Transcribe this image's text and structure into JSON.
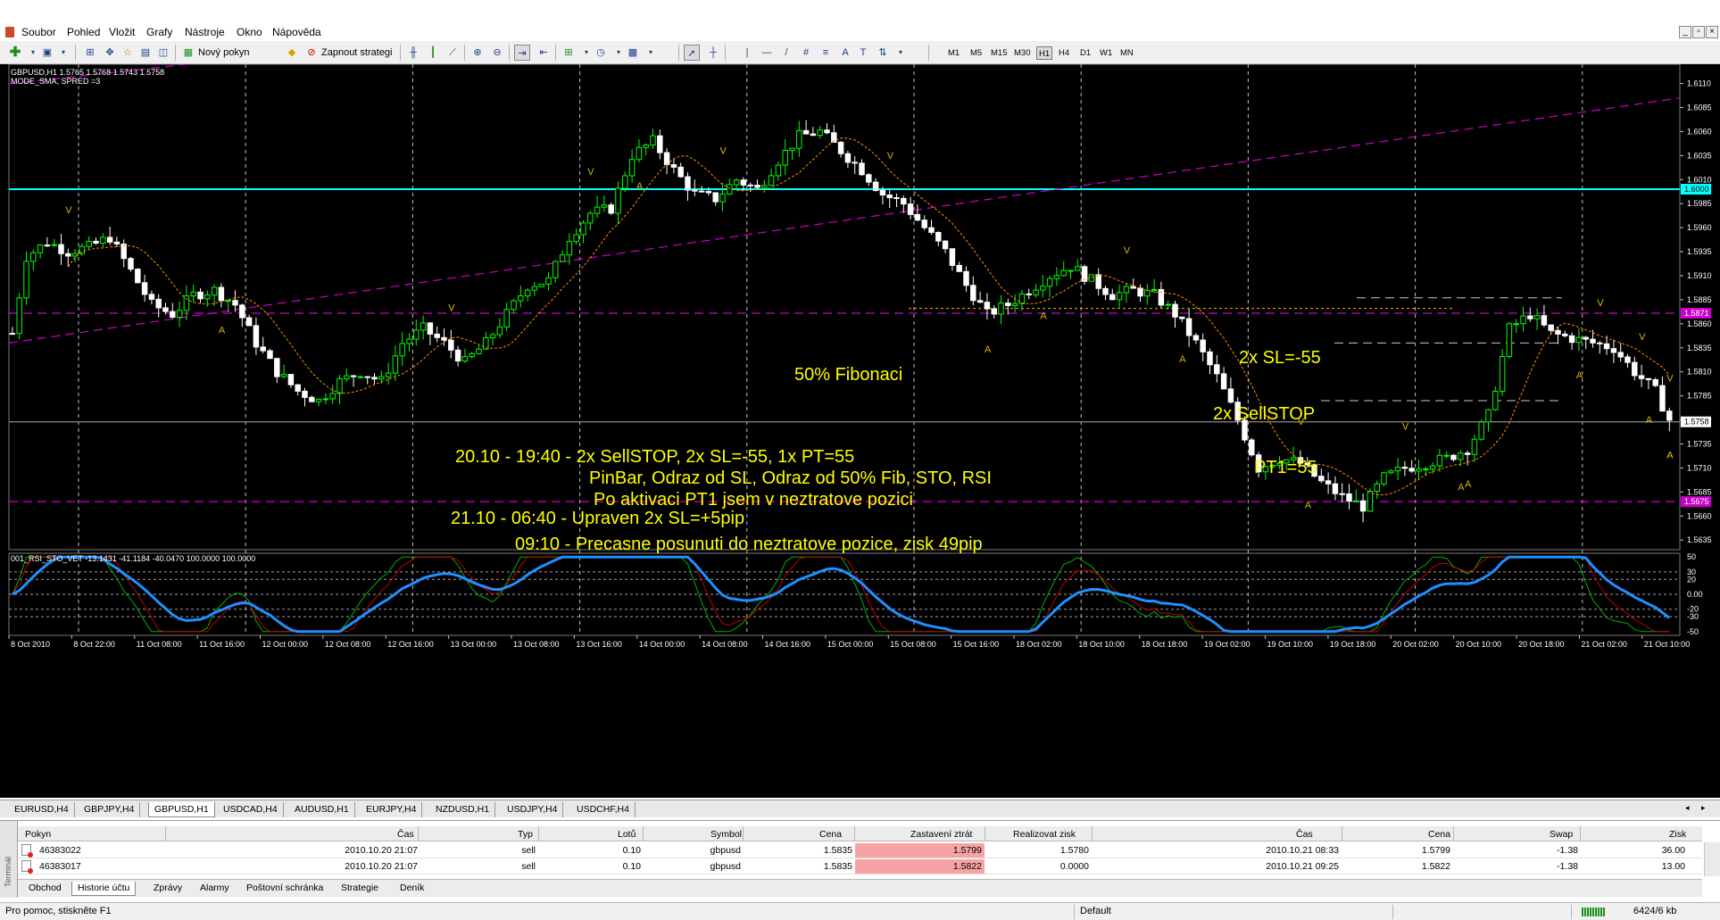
{
  "menu": {
    "items": [
      "Soubor",
      "Pohled",
      "Vložit",
      "Grafy",
      "Nástroje",
      "Okno",
      "Nápověda"
    ],
    "window_controls": [
      "_",
      "▫",
      "×"
    ]
  },
  "toolbar": {
    "new_order_label": "Nový pokyn",
    "auto_trading_label": "Zapnout strategie",
    "drawing_tools": [
      "|",
      "—",
      "/",
      "#",
      "≡",
      "A",
      "T"
    ],
    "timeframes": [
      "M1",
      "M5",
      "M15",
      "M30",
      "H1",
      "H4",
      "D1",
      "W1",
      "MN"
    ],
    "active_timeframe": "H1"
  },
  "chart_data": {
    "type": "candlestick",
    "info_line_1": "GBPUSD,H1  1.5765 1.5768 1.5743 1.5758",
    "info_line_2": "MODE_SMA, SPRED =3",
    "y_ticks": [
      "1.6110",
      "1.6085",
      "1.6060",
      "1.6035",
      "1.6010",
      "1.5985",
      "1.5960",
      "1.5935",
      "1.5910",
      "1.5885",
      "1.5860",
      "1.5835",
      "1.5810",
      "1.5785",
      "1.5760",
      "1.5735",
      "1.5710",
      "1.5685",
      "1.5660",
      "1.5635"
    ],
    "ylim": [
      1.5625,
      1.613
    ],
    "x_ticks": [
      "8 Oct 2010",
      "8 Oct 22:00",
      "11 Oct 08:00",
      "11 Oct 16:00",
      "12 Oct 00:00",
      "12 Oct 08:00",
      "12 Oct 16:00",
      "13 Oct 00:00",
      "13 Oct 08:00",
      "13 Oct 16:00",
      "14 Oct 00:00",
      "14 Oct 08:00",
      "14 Oct 16:00",
      "15 Oct 00:00",
      "15 Oct 08:00",
      "15 Oct 16:00",
      "18 Oct 02:00",
      "18 Oct 10:00",
      "18 Oct 18:00",
      "19 Oct 02:00",
      "19 Oct 10:00",
      "19 Oct 18:00",
      "20 Oct 02:00",
      "20 Oct 10:00",
      "20 Oct 18:00",
      "21 Oct 02:00",
      "21 Oct 10:00"
    ],
    "price_labels": [
      {
        "text": "1.6000",
        "value": 1.6,
        "color": "#00ffff"
      },
      {
        "text": "1.5871",
        "value": 1.5871,
        "color": "#cc00cc"
      },
      {
        "text": "1.5758",
        "value": 1.5758,
        "color": "#ffffff"
      },
      {
        "text": "1.5675",
        "value": 1.5675,
        "color": "#cc00cc"
      }
    ],
    "close_path": [
      [
        0,
        1.585
      ],
      [
        2,
        1.593
      ],
      [
        5,
        1.5945
      ],
      [
        8,
        1.5935
      ],
      [
        11,
        1.594
      ],
      [
        14,
        1.595
      ],
      [
        17,
        1.5915
      ],
      [
        20,
        1.588
      ],
      [
        23,
        1.587
      ],
      [
        26,
        1.589
      ],
      [
        29,
        1.5895
      ],
      [
        32,
        1.588
      ],
      [
        35,
        1.584
      ],
      [
        38,
        1.581
      ],
      [
        41,
        1.579
      ],
      [
        44,
        1.578
      ],
      [
        47,
        1.58
      ],
      [
        50,
        1.581
      ],
      [
        53,
        1.58
      ],
      [
        56,
        1.584
      ],
      [
        59,
        1.5855
      ],
      [
        62,
        1.584
      ],
      [
        65,
        1.582
      ],
      [
        68,
        1.584
      ],
      [
        71,
        1.587
      ],
      [
        74,
        1.59
      ],
      [
        77,
        1.5905
      ],
      [
        80,
        1.595
      ],
      [
        83,
        1.5975
      ],
      [
        86,
        1.598
      ],
      [
        89,
        1.6035
      ],
      [
        92,
        1.605
      ],
      [
        95,
        1.602
      ],
      [
        98,
        1.5995
      ],
      [
        101,
        1.599
      ],
      [
        104,
        1.601
      ],
      [
        107,
        1.6
      ],
      [
        110,
        1.603
      ],
      [
        113,
        1.6055
      ],
      [
        116,
        1.606
      ],
      [
        119,
        1.604
      ],
      [
        122,
        1.602
      ],
      [
        125,
        1.5995
      ],
      [
        128,
        1.5985
      ],
      [
        131,
        1.596
      ],
      [
        134,
        1.5935
      ],
      [
        137,
        1.59
      ],
      [
        140,
        1.587
      ],
      [
        143,
        1.588
      ],
      [
        146,
        1.5895
      ],
      [
        149,
        1.591
      ],
      [
        152,
        1.592
      ],
      [
        155,
        1.5905
      ],
      [
        158,
        1.589
      ],
      [
        161,
        1.5895
      ],
      [
        164,
        1.589
      ],
      [
        167,
        1.587
      ],
      [
        170,
        1.584
      ],
      [
        173,
        1.5805
      ],
      [
        176,
        1.576
      ],
      [
        179,
        1.571
      ],
      [
        182,
        1.572
      ],
      [
        185,
        1.5715
      ],
      [
        188,
        1.5695
      ],
      [
        191,
        1.568
      ],
      [
        194,
        1.567
      ],
      [
        197,
        1.57
      ],
      [
        200,
        1.571
      ],
      [
        203,
        1.5715
      ],
      [
        206,
        1.572
      ],
      [
        209,
        1.573
      ],
      [
        212,
        1.5765
      ],
      [
        215,
        1.5855
      ],
      [
        218,
        1.587
      ],
      [
        221,
        1.585
      ],
      [
        224,
        1.5845
      ],
      [
        227,
        1.584
      ],
      [
        230,
        1.5835
      ],
      [
        233,
        1.581
      ],
      [
        236,
        1.579
      ],
      [
        238,
        1.576
      ]
    ],
    "bar_count": 240,
    "horizontal_lines": [
      {
        "value": 1.6,
        "color": "#00ffff",
        "style": "solid"
      },
      {
        "value": 1.5871,
        "color": "#cc00cc",
        "style": "dashed"
      },
      {
        "value": 1.5675,
        "color": "#cc00cc",
        "style": "dashed"
      },
      {
        "value": 1.5758,
        "color": "#8a8a8a",
        "style": "solid"
      }
    ],
    "annotations": [
      {
        "text": "50% Fibonaci",
        "color": "#ffff00"
      },
      {
        "text": "2x SL=-55",
        "color": "#ffff00"
      },
      {
        "text": "2x SellSTOP",
        "color": "#ffff00"
      },
      {
        "text": "PT1=55",
        "color": "#ffff00"
      },
      {
        "text": "20.10 - 19:40 - 2x SellSTOP, 2x SL=-55, 1x PT=55",
        "color": "#ffff00"
      },
      {
        "text": "PinBar, Odraz od SL, Odraz od 50% Fib, STO, RSI",
        "color": "#ffff00"
      },
      {
        "text": "Po aktivaci PT1 jsem v neztratove pozici",
        "color": "#ffff00"
      },
      {
        "text": "21.10 - 06:40 - Upraven 2x SL=+5pip",
        "color": "#ffff00"
      },
      {
        "text": "09:10 - Precasne posunuti do neztratove pozice, zisk 49pip",
        "color": "#ffff00"
      }
    ],
    "fractal_markers": [
      "V",
      "A",
      "V",
      "V",
      "A",
      "V",
      "V",
      "A",
      "A",
      "V",
      "A",
      "V",
      "V",
      "A",
      "A",
      "A",
      "A",
      "V",
      "V",
      "A",
      "A",
      "V",
      "A"
    ],
    "indicator": {
      "title": "001_RSI_STO_VET -13.1431 -41.1184 -40.0470 100.0000 100.0000",
      "y_ticks": [
        "50",
        "30",
        "20",
        "0.00",
        "-20",
        "-30",
        "-50"
      ],
      "ylim": [
        -55,
        55
      ],
      "levels": [
        30,
        20,
        0,
        -20,
        -30
      ],
      "series_colors": {
        "main": "#1e90ff",
        "stoch_k": "#00b000",
        "stoch_d": "#c00000"
      }
    },
    "colors": {
      "bull": "#00ff00",
      "bear": "#ffffff",
      "grid": "#c0c0c0",
      "trend": "#cc00cc",
      "ma": "#ff8c00"
    }
  },
  "chart_tabs": {
    "items": [
      "EURUSD,H4",
      "GBPJPY,H4",
      "GBPUSD,H1",
      "USDCAD,H4",
      "AUDUSD,H1",
      "EURJPY,H4",
      "NZDUSD,H1",
      "USDJPY,H4",
      "USDCHF,H4"
    ],
    "active": "GBPUSD,H1"
  },
  "terminal": {
    "side_label": "Terminál",
    "columns": [
      "Pokyn",
      "Čas",
      "Typ",
      "Lotů",
      "Symbol",
      "Cena",
      "Zastavení ztrát",
      "Realizovat zisk",
      "Čas",
      "Cena",
      "Swap",
      "Zisk"
    ],
    "rows": [
      [
        "46383022",
        "2010.10.20 21:07",
        "sell",
        "0.10",
        "gbpusd",
        "1.5835",
        "1.5799",
        "1.5780",
        "2010.10.21 08:33",
        "1.5799",
        "-1.38",
        "36.00"
      ],
      [
        "46383017",
        "2010.10.20 21:07",
        "sell",
        "0.10",
        "gbpusd",
        "1.5835",
        "1.5822",
        "0.0000",
        "2010.10.21 09:25",
        "1.5822",
        "-1.38",
        "13.00"
      ]
    ],
    "tabs": [
      "Obchod",
      "Historie účtu",
      "Zprávy",
      "Alarmy",
      "Poštovní schránka",
      "Strategie",
      "Deník"
    ],
    "active_tab": "Historie účtu"
  },
  "status": {
    "help": "Pro pomoc, stiskněte F1",
    "profile": "Default",
    "traffic": "6424/6 kb"
  }
}
